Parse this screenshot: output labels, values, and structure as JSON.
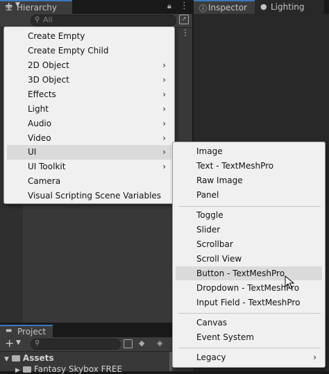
{
  "hierarchy": {
    "tab_label": "Hierarchy",
    "search_placeholder": "All"
  },
  "inspector": {
    "tabs": [
      {
        "label": "Inspector"
      },
      {
        "label": "Lighting"
      }
    ]
  },
  "project": {
    "tab_label": "Project",
    "tree": [
      {
        "label": "Assets"
      },
      {
        "label": "Fantasy Skybox FREE"
      }
    ]
  },
  "create_menu": {
    "items": [
      {
        "label": "Create Empty",
        "has_submenu": false
      },
      {
        "label": "Create Empty Child",
        "has_submenu": false
      },
      {
        "label": "2D Object",
        "has_submenu": true
      },
      {
        "label": "3D Object",
        "has_submenu": true
      },
      {
        "label": "Effects",
        "has_submenu": true
      },
      {
        "label": "Light",
        "has_submenu": true
      },
      {
        "label": "Audio",
        "has_submenu": true
      },
      {
        "label": "Video",
        "has_submenu": true
      },
      {
        "label": "UI",
        "has_submenu": true,
        "highlighted": true
      },
      {
        "label": "UI Toolkit",
        "has_submenu": true
      },
      {
        "label": "Camera",
        "has_submenu": false
      },
      {
        "label": "Visual Scripting Scene Variables",
        "has_submenu": false
      }
    ]
  },
  "ui_submenu": {
    "groups": [
      [
        "Image",
        "Text - TextMeshPro",
        "Raw Image",
        "Panel"
      ],
      [
        "Toggle",
        "Slider",
        "Scrollbar",
        "Scroll View",
        "Button - TextMeshPro",
        "Dropdown - TextMeshPro",
        "Input Field - TextMeshPro"
      ],
      [
        "Canvas",
        "Event System"
      ]
    ],
    "legacy_label": "Legacy",
    "highlighted_item": "Button - TextMeshPro"
  },
  "icons": {
    "hierarchy_tab": "list-icon",
    "lock": "lock-icon",
    "options": "kebab-menu-icon",
    "add": "plus-icon",
    "search": "search-icon",
    "inspector_tab": "info-icon",
    "lighting_tab": "lightbulb-icon",
    "submenu_arrow": "chevron-right-icon",
    "folder": "folder-icon",
    "cursor": "mouse-pointer-icon"
  },
  "colors": {
    "menu_bg": "#f0f0f0",
    "menu_highlight": "#dadada",
    "tab_accent": "#3a79bb",
    "panel_bg": "#383838"
  }
}
